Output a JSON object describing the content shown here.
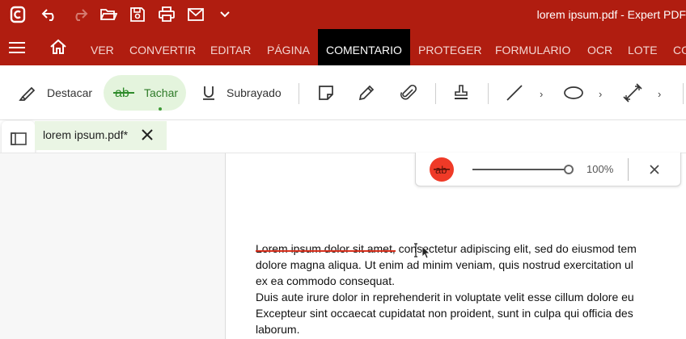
{
  "app": {
    "window_title": "lorem ipsum.pdf   -   Expert PDF",
    "brand_color": "#b01d10"
  },
  "quick_access": [
    {
      "name": "app-logo-icon"
    },
    {
      "name": "undo-icon"
    },
    {
      "name": "redo-icon"
    },
    {
      "name": "open-folder-icon"
    },
    {
      "name": "save-icon"
    },
    {
      "name": "print-icon"
    },
    {
      "name": "email-icon"
    },
    {
      "name": "chevron-down-icon"
    }
  ],
  "ribbon": {
    "tabs": [
      "VER",
      "CONVERTIR",
      "EDITAR",
      "PÁGINA",
      "COMENTARIO",
      "PROTEGER",
      "FORMULARIO",
      "OCR",
      "LOTE",
      "CO"
    ],
    "active_tab": "COMENTARIO"
  },
  "toolbar": {
    "highlight_label": "Destacar",
    "strikeout_label": "Tachar",
    "underline_label": "Subrayado",
    "active_tool": "Tachar",
    "active_color": "#e4f4dd"
  },
  "document_tab": {
    "name": "lorem ipsum.pdf*"
  },
  "annotation_bar": {
    "color": "#ef3a27",
    "opacity_value": 100,
    "opacity_label": "100%"
  },
  "document": {
    "struck_text": "Lorem ipsum dolor sit amet,",
    "line1_rest": " consectetur adipiscing elit, sed do eiusmod tem",
    "lines": [
      "dolore magna aliqua. Ut enim ad minim veniam, quis nostrud exercitation ul",
      "ex ea commodo consequat.",
      "Duis aute irure dolor in reprehenderit in voluptate velit esse cillum dolore eu",
      "Excepteur sint occaecat cupidatat non proident, sunt in culpa qui officia des",
      "laborum."
    ]
  }
}
